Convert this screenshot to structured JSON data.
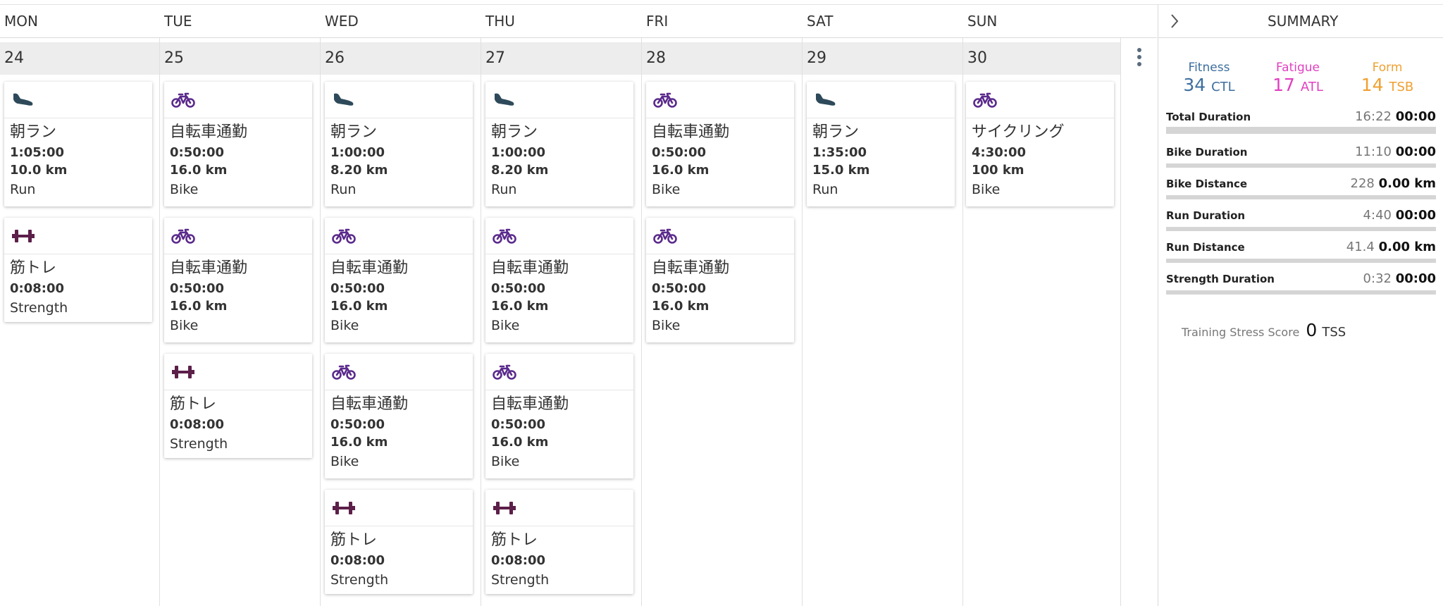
{
  "calendar": {
    "days": [
      {
        "name": "MON",
        "date": "24"
      },
      {
        "name": "TUE",
        "date": "25"
      },
      {
        "name": "WED",
        "date": "26"
      },
      {
        "name": "THU",
        "date": "27"
      },
      {
        "name": "FRI",
        "date": "28"
      },
      {
        "name": "SAT",
        "date": "29"
      },
      {
        "name": "SUN",
        "date": "30"
      }
    ],
    "more_menu": "more-options",
    "workouts": {
      "mon": [
        {
          "icon": "run-shoe-icon",
          "title": "朝ラン",
          "duration": "1:05:00",
          "distance": "10.0 km",
          "type": "Run"
        },
        {
          "icon": "dumbbell-icon",
          "title": "筋トレ",
          "duration": "0:08:00",
          "type": "Strength"
        }
      ],
      "tue": [
        {
          "icon": "bike-icon",
          "title": "自転車通勤",
          "duration": "0:50:00",
          "distance": "16.0 km",
          "type": "Bike"
        },
        {
          "icon": "bike-icon",
          "title": "自転車通勤",
          "duration": "0:50:00",
          "distance": "16.0 km",
          "type": "Bike"
        },
        {
          "icon": "dumbbell-icon",
          "title": "筋トレ",
          "duration": "0:08:00",
          "type": "Strength"
        }
      ],
      "wed": [
        {
          "icon": "run-shoe-icon",
          "title": "朝ラン",
          "duration": "1:00:00",
          "distance": "8.20 km",
          "type": "Run"
        },
        {
          "icon": "bike-icon",
          "title": "自転車通勤",
          "duration": "0:50:00",
          "distance": "16.0 km",
          "type": "Bike"
        },
        {
          "icon": "bike-icon",
          "title": "自転車通勤",
          "duration": "0:50:00",
          "distance": "16.0 km",
          "type": "Bike"
        },
        {
          "icon": "dumbbell-icon",
          "title": "筋トレ",
          "duration": "0:08:00",
          "type": "Strength"
        }
      ],
      "thu": [
        {
          "icon": "run-shoe-icon",
          "title": "朝ラン",
          "duration": "1:00:00",
          "distance": "8.20 km",
          "type": "Run"
        },
        {
          "icon": "bike-icon",
          "title": "自転車通勤",
          "duration": "0:50:00",
          "distance": "16.0 km",
          "type": "Bike"
        },
        {
          "icon": "bike-icon",
          "title": "自転車通勤",
          "duration": "0:50:00",
          "distance": "16.0 km",
          "type": "Bike"
        },
        {
          "icon": "dumbbell-icon",
          "title": "筋トレ",
          "duration": "0:08:00",
          "type": "Strength"
        }
      ],
      "fri": [
        {
          "icon": "bike-icon",
          "title": "自転車通勤",
          "duration": "0:50:00",
          "distance": "16.0 km",
          "type": "Bike"
        },
        {
          "icon": "bike-icon",
          "title": "自転車通勤",
          "duration": "0:50:00",
          "distance": "16.0 km",
          "type": "Bike"
        }
      ],
      "sat": [
        {
          "icon": "run-shoe-icon",
          "title": "朝ラン",
          "duration": "1:35:00",
          "distance": "15.0 km",
          "type": "Run"
        }
      ],
      "sun": [
        {
          "icon": "bike-icon",
          "title": "サイクリング",
          "duration": "4:30:00",
          "distance": "100 km",
          "type": "Bike"
        }
      ]
    }
  },
  "summary": {
    "title": "SUMMARY",
    "metrics": {
      "fitness": {
        "label": "Fitness",
        "value": "34",
        "unit": "CTL",
        "color": "#3d6e9e"
      },
      "fatigue": {
        "label": "Fatigue",
        "value": "17",
        "unit": "ATL",
        "color": "#e040c0"
      },
      "form": {
        "label": "Form",
        "value": "14",
        "unit": "TSB",
        "color": "#f0a030"
      }
    },
    "stats": [
      {
        "label": "Total Duration",
        "actual": "16:22",
        "planned": "00:00",
        "progress": 0
      },
      {
        "label": "Bike Duration",
        "actual": "11:10",
        "planned": "00:00",
        "progress": 0
      },
      {
        "label": "Bike Distance",
        "actual": "228",
        "planned": "0.00 km",
        "progress": 0
      },
      {
        "label": "Run Duration",
        "actual": "4:40",
        "planned": "00:00",
        "progress": 0
      },
      {
        "label": "Run Distance",
        "actual": "41.4",
        "planned": "0.00 km",
        "progress": 0
      },
      {
        "label": "Strength Duration",
        "actual": "0:32",
        "planned": "00:00",
        "progress": 0
      }
    ],
    "tss": {
      "label": "Training Stress Score",
      "value": "0",
      "unit": "TSS"
    }
  },
  "colors": {
    "run_icon": "#2e4a5a",
    "bike_icon": "#5b2a8c",
    "strength_icon": "#5c1f4a"
  }
}
